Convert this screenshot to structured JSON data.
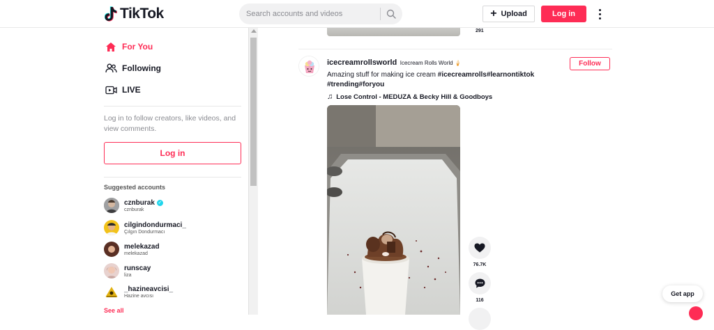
{
  "header": {
    "logo_text": "TikTok",
    "search_placeholder": "Search accounts and videos",
    "upload_label": "Upload",
    "login_label": "Log in"
  },
  "sidebar": {
    "nav": [
      {
        "label": "For You",
        "icon": "home-icon"
      },
      {
        "label": "Following",
        "icon": "users-icon"
      },
      {
        "label": "LIVE",
        "icon": "live-icon"
      }
    ],
    "login_hint": "Log in to follow creators, like videos, and view comments.",
    "login_label": "Log in",
    "suggested_title": "Suggested accounts",
    "accounts": [
      {
        "name": "cznburak",
        "sub": "cznburak",
        "verified": true
      },
      {
        "name": "cilgindondurmaci_",
        "sub": "Çılgın Dondurmacı"
      },
      {
        "name": "melekazad",
        "sub": "melekazad"
      },
      {
        "name": "runscay",
        "sub": "liza"
      },
      {
        "name": "_hazineavcisi_",
        "sub": "Hazine avcısı"
      }
    ],
    "see_all": "See all"
  },
  "feed": {
    "prev_count": "291",
    "post": {
      "username": "icecreamrollsworld",
      "nickname": "Icecream Rolls World 🍦",
      "desc_text": "Amazing stuff for making ice cream ",
      "tags_line1": "#icecreamrolls#learnontiktok",
      "tags_line2": "#trending#foryou",
      "music": "Lose Control - MEDUZA & Becky Hill & Goodboys",
      "follow_label": "Follow",
      "likes": "76.7K",
      "comments": "116"
    }
  },
  "get_app": "Get app",
  "colors": {
    "accent": "#fe2c55",
    "verified": "#20d5ec"
  }
}
